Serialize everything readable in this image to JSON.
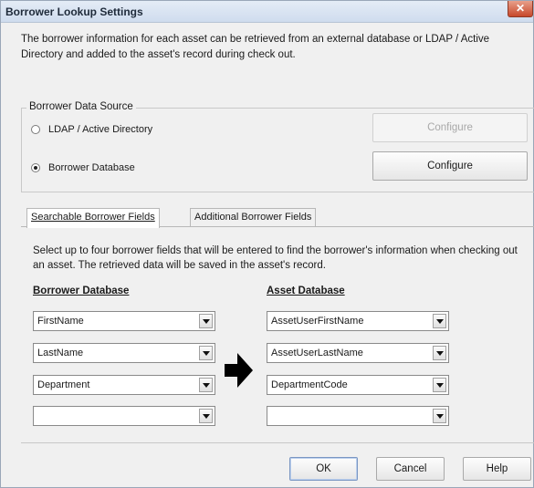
{
  "window": {
    "title": "Borrower Lookup Settings",
    "close_glyph": "✕"
  },
  "description": "The borrower information for each asset can be retrieved from an external database or LDAP / Active Directory and added to the asset's record during check out.",
  "data_source": {
    "label": "Borrower Data Source",
    "options": [
      {
        "label": "LDAP / Active Directory",
        "selected": false,
        "configure_label": "Configure",
        "configure_enabled": false
      },
      {
        "label": "Borrower Database",
        "selected": true,
        "configure_label": "Configure",
        "configure_enabled": true
      }
    ]
  },
  "tabs": [
    {
      "label": "Searchable Borrower Fields",
      "active": true
    },
    {
      "label": "Additional Borrower Fields",
      "active": false
    }
  ],
  "tab_description": "Select up to four borrower fields that will be entered to find the borrower's information when checking out an asset. The retrieved data will be saved in the asset's record.",
  "columns": {
    "borrower_header": "Borrower Database",
    "asset_header": "Asset Database"
  },
  "field_rows": [
    {
      "borrower": "FirstName",
      "asset": "AssetUserFirstName"
    },
    {
      "borrower": "LastName",
      "asset": "AssetUserLastName"
    },
    {
      "borrower": "Department",
      "asset": "DepartmentCode"
    },
    {
      "borrower": "",
      "asset": ""
    }
  ],
  "buttons": {
    "ok": "OK",
    "cancel": "Cancel",
    "help": "Help"
  }
}
